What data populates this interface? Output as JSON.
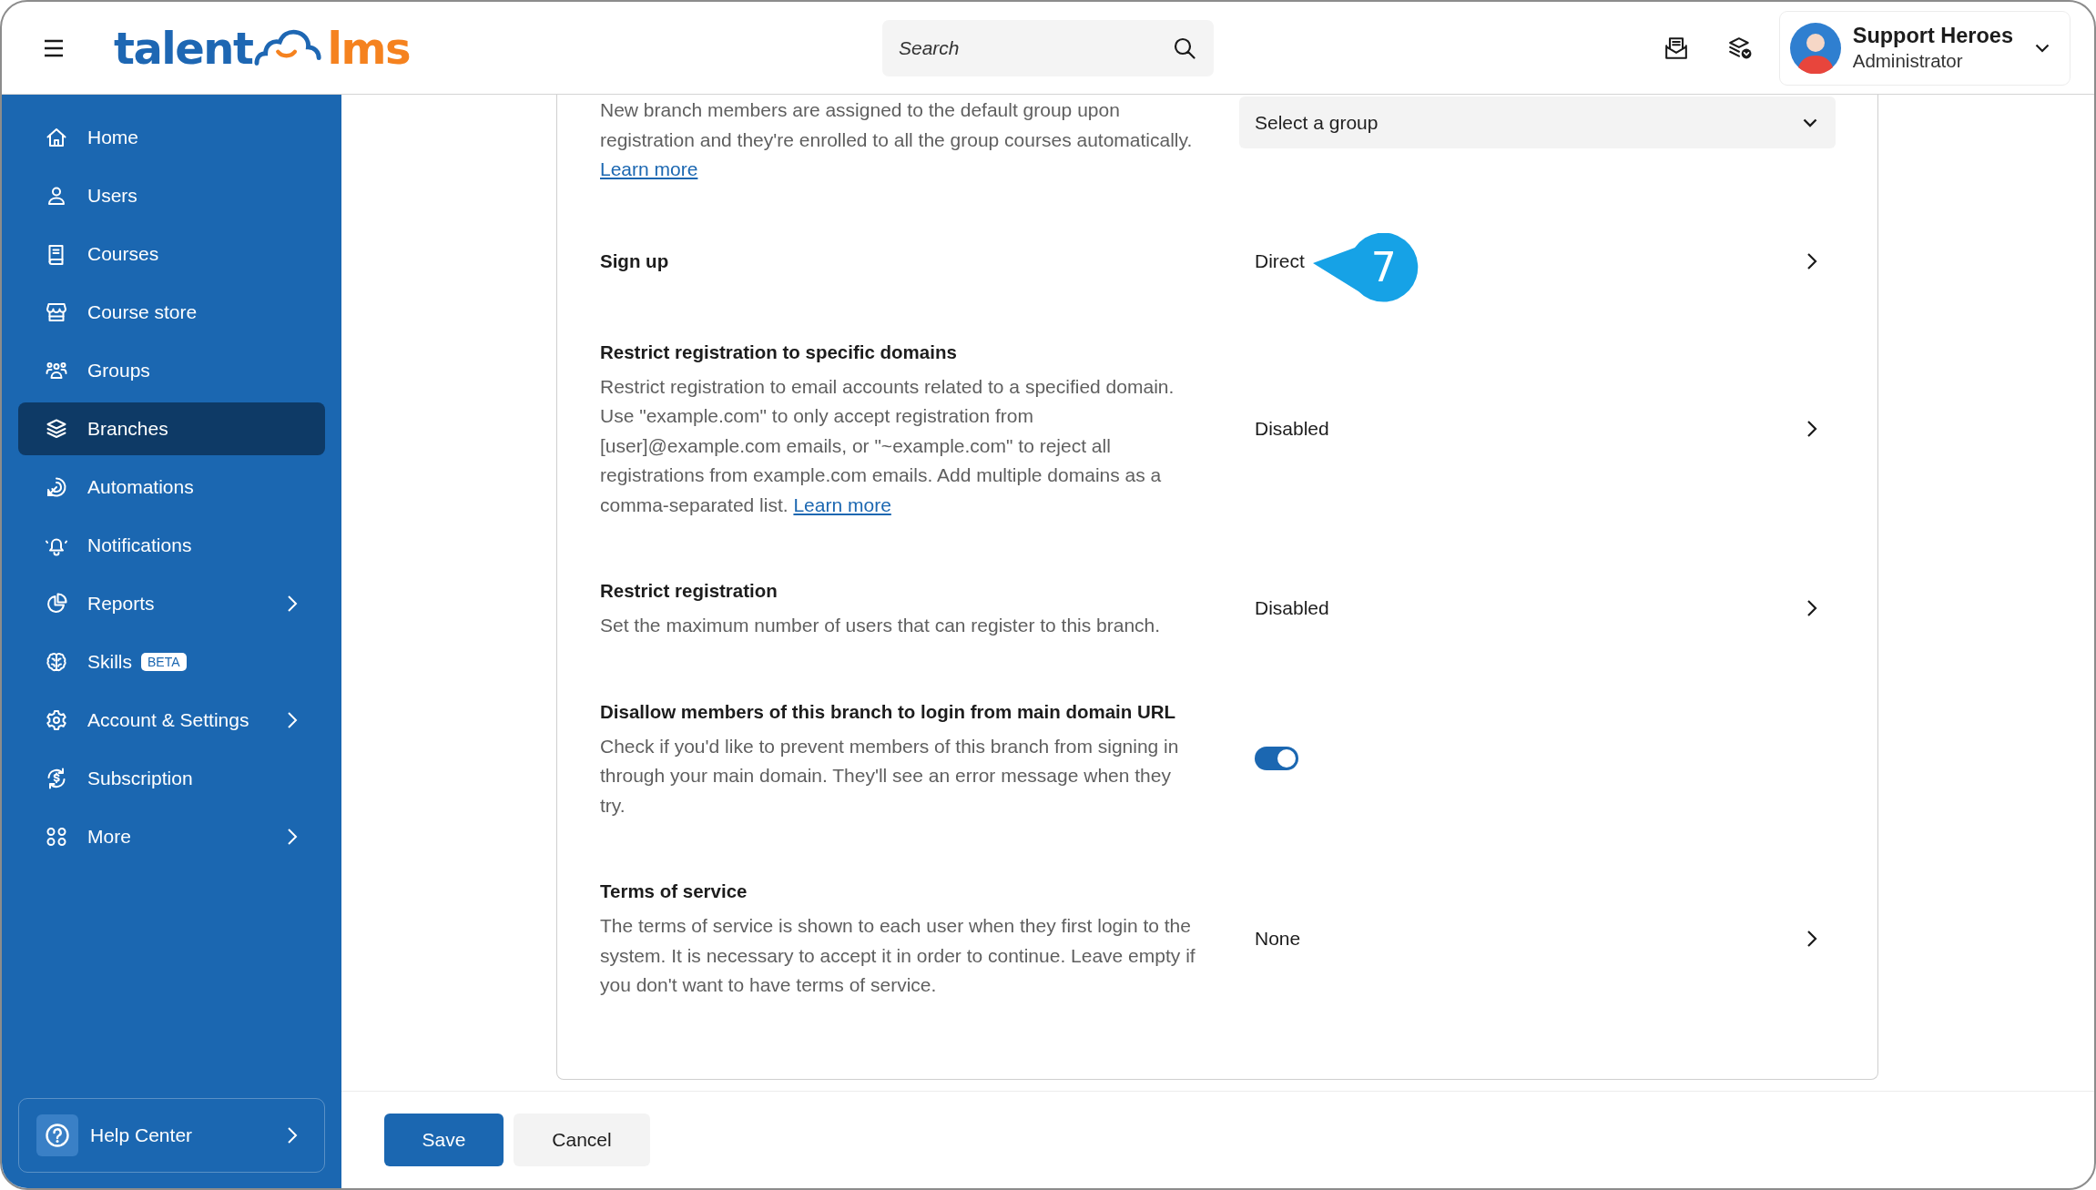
{
  "header": {
    "logo": {
      "wordmark_start": "talent",
      "wordmark_end": "lms"
    },
    "search": {
      "placeholder": "Search"
    },
    "user": {
      "name": "Support Heroes",
      "role": "Administrator"
    }
  },
  "sidebar": {
    "items": [
      {
        "label": "Home",
        "selected": false,
        "expandable": false
      },
      {
        "label": "Users",
        "selected": false,
        "expandable": false
      },
      {
        "label": "Courses",
        "selected": false,
        "expandable": false
      },
      {
        "label": "Course store",
        "selected": false,
        "expandable": false
      },
      {
        "label": "Groups",
        "selected": false,
        "expandable": false
      },
      {
        "label": "Branches",
        "selected": true,
        "expandable": false
      },
      {
        "label": "Automations",
        "selected": false,
        "expandable": false
      },
      {
        "label": "Notifications",
        "selected": false,
        "expandable": false
      },
      {
        "label": "Reports",
        "selected": false,
        "expandable": true
      },
      {
        "label": "Skills",
        "selected": false,
        "expandable": false,
        "badge": "BETA"
      },
      {
        "label": "Account & Settings",
        "selected": false,
        "expandable": true
      },
      {
        "label": "Subscription",
        "selected": false,
        "expandable": false
      },
      {
        "label": "More",
        "selected": false,
        "expandable": true
      }
    ],
    "help": {
      "label": "Help Center"
    }
  },
  "settings": [
    {
      "kind": "select",
      "description": "New branch members are assigned to the default group upon registration and they're enrolled to all the group courses automatically.",
      "link": "Learn more",
      "placeholder": "Select a group"
    },
    {
      "kind": "link",
      "title": "Sign up",
      "value": "Direct",
      "callout": "7"
    },
    {
      "kind": "link",
      "title": "Restrict registration to specific domains",
      "description": "Restrict registration to email accounts related to a specified domain. Use \"example.com\" to only accept registration from [user]@example.com emails, or \"~example.com\" to reject all registrations from example.com emails. Add multiple domains as a comma-separated list.",
      "link": "Learn more",
      "value": "Disabled"
    },
    {
      "kind": "link",
      "title": "Restrict registration",
      "description": "Set the maximum number of users that can register to this branch.",
      "value": "Disabled"
    },
    {
      "kind": "toggle",
      "title": "Disallow members of this branch to login from main domain URL",
      "description": "Check if you'd like to prevent members of this branch from signing in through your main domain. They'll see an error message when they try.",
      "on": true
    },
    {
      "kind": "link",
      "title": "Terms of service",
      "description": "The terms of service is shown to each user when they first login to the system. It is necessary to accept it in order to continue. Leave empty if you don't want to have terms of service.",
      "value": "None"
    }
  ],
  "footer": {
    "buttons": [
      {
        "label": "Save",
        "kind": "primary"
      },
      {
        "label": "Cancel",
        "kind": "secondary"
      }
    ]
  }
}
